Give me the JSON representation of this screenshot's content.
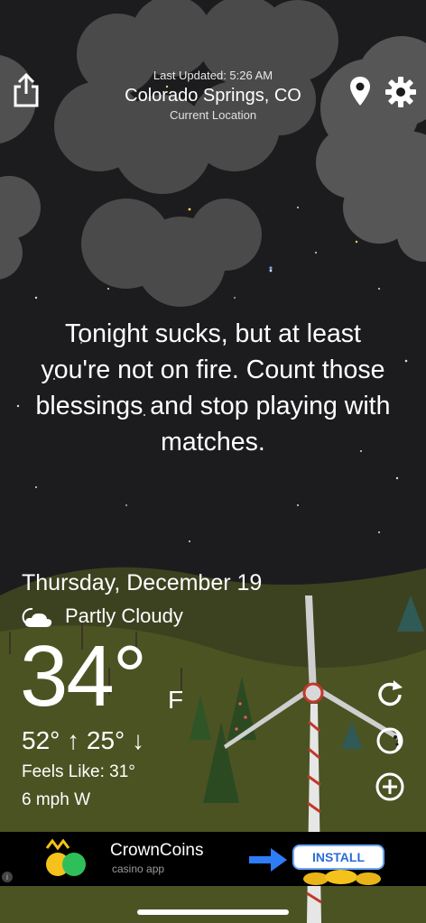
{
  "header": {
    "last_updated": "Last Updated: 5:26 AM",
    "city": "Colorado Springs, CO",
    "current_location": "Current Location"
  },
  "quote": "Tonight sucks, but at least you're not on fire. Count those blessings and stop playing with matches.",
  "weather": {
    "date": "Thursday, December 19",
    "condition": "Partly Cloudy",
    "temperature": "34°",
    "unit": "F",
    "hi_lo": "52° ↑  25° ↓",
    "feels_like": "Feels Like: 31°",
    "wind": "6 mph W"
  },
  "icons": {
    "share": "share-icon",
    "location": "location-pin-icon",
    "settings": "gear-icon",
    "refresh": "refresh-icon",
    "radar": "moon-phase-icon",
    "add": "add-icon",
    "condition": "partly-cloudy-icon"
  },
  "ad": {
    "title": "CrownCoins",
    "subtitle": "casino app",
    "cta": "INSTALL",
    "info": "i"
  },
  "colors": {
    "sky": "#1c1c1e",
    "cloud": "#4a4a4a",
    "hill": "#4b5323",
    "accent": "#2a6bd8"
  }
}
